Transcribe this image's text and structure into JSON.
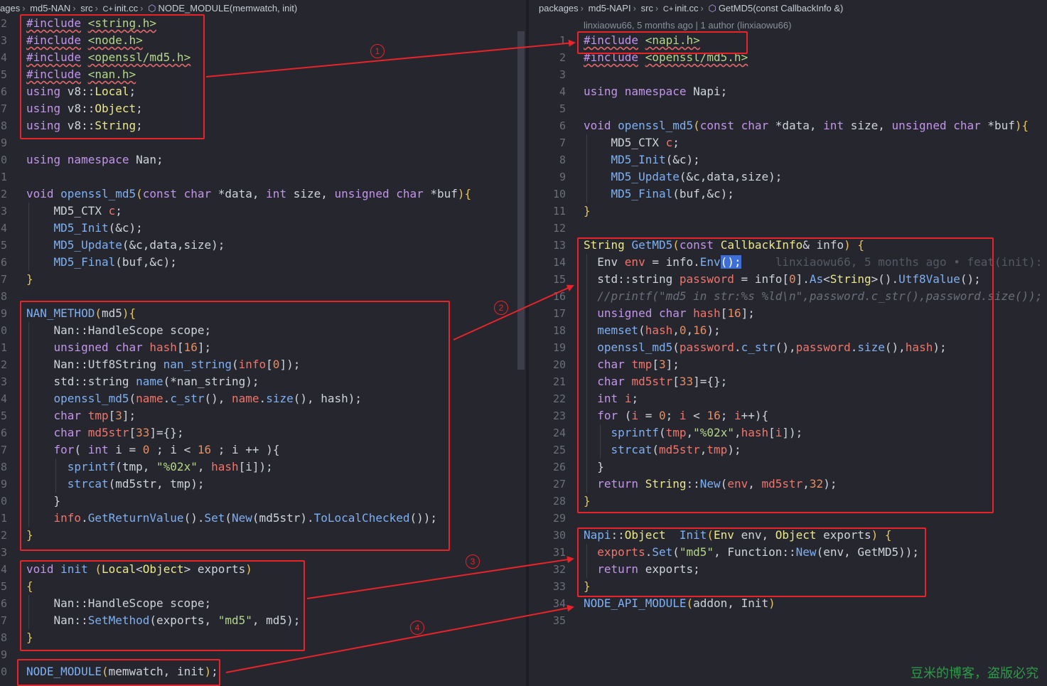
{
  "left_editor": {
    "breadcrumb": [
      "ages",
      "md5-NAN",
      "src",
      "init.cc",
      "NODE_MODULE(memwatch, init)"
    ],
    "lines": [
      {
        "n": "2",
        "html": "<span class=\"pp\">#include</span> <span class=\"ppstr\">&lt;string.h&gt;</span>"
      },
      {
        "n": "3",
        "html": "<span class=\"pp\">#include</span> <span class=\"ppstr\">&lt;node.h&gt;</span>"
      },
      {
        "n": "4",
        "html": "<span class=\"pp\">#include</span> <span class=\"ppstr\">&lt;openssl/md5.h&gt;</span>"
      },
      {
        "n": "5",
        "html": "<span class=\"pp\">#include</span> <span class=\"ppstr\">&lt;nan.h&gt;</span>"
      },
      {
        "n": "6",
        "html": "<span class=\"kw\">using</span> v8::<span class=\"ty\">Local</span>;"
      },
      {
        "n": "7",
        "html": "<span class=\"kw\">using</span> v8::<span class=\"ty\">Object</span>;"
      },
      {
        "n": "8",
        "html": "<span class=\"kw\">using</span> v8::<span class=\"ty\">String</span>;"
      },
      {
        "n": "9",
        "html": ""
      },
      {
        "n": "0",
        "html": "<span class=\"kw\">using namespace</span> Nan;"
      },
      {
        "n": "1",
        "html": ""
      },
      {
        "n": "2",
        "html": "<span class=\"kw\">void</span> <span class=\"fn\">openssl_md5</span><span class=\"br\">(</span><span class=\"kw\">const char</span> *data, <span class=\"kw\">int</span> size, <span class=\"kw\">unsigned char</span> *buf<span class=\"br\">){</span>"
      },
      {
        "n": "3",
        "html": "    MD5_CTX <span class=\"var\">c</span>;"
      },
      {
        "n": "4",
        "html": "    <span class=\"fn\">MD5_Init</span>(&amp;c);"
      },
      {
        "n": "5",
        "html": "    <span class=\"fn\">MD5_Update</span>(&amp;c,data,size);"
      },
      {
        "n": "6",
        "html": "    <span class=\"fn\">MD5_Final</span>(buf,&amp;c);"
      },
      {
        "n": "7",
        "html": "<span class=\"br\">}</span>"
      },
      {
        "n": "8",
        "html": ""
      },
      {
        "n": "9",
        "html": "<span class=\"fn\">NAN_METHOD</span><span class=\"br\">(</span>md5<span class=\"br\">){</span>"
      },
      {
        "n": "0",
        "html": "    Nan::HandleScope scope;"
      },
      {
        "n": "1",
        "html": "    <span class=\"kw\">unsigned char</span> <span class=\"var\">hash</span>[<span class=\"num\">16</span>];"
      },
      {
        "n": "2",
        "html": "    Nan::Utf8String <span class=\"fn\">nan_string</span>(<span class=\"var\">info</span>[<span class=\"num\">0</span>]);"
      },
      {
        "n": "3",
        "html": "    std::string <span class=\"fn\">name</span>(*nan_string);"
      },
      {
        "n": "4",
        "html": "    <span class=\"fn\">openssl_md5</span>(<span class=\"var\">name</span>.<span class=\"fn\">c_str</span>(), <span class=\"var\">name</span>.<span class=\"fn\">size</span>(), hash);"
      },
      {
        "n": "5",
        "html": "    <span class=\"kw\">char</span> <span class=\"var\">tmp</span>[<span class=\"num\">3</span>];"
      },
      {
        "n": "6",
        "html": "    <span class=\"kw\">char</span> <span class=\"var\">md5str</span>[<span class=\"num\">33</span>]={};"
      },
      {
        "n": "7",
        "html": "    <span class=\"kw\">for</span>( <span class=\"kw\">int</span> i = <span class=\"num\">0</span> ; i &lt; <span class=\"num\">16</span> ; i ++ ){"
      },
      {
        "n": "8",
        "html": "      <span class=\"fn\">sprintf</span>(tmp, <span class=\"str\">\"%02x\"</span>, <span class=\"var\">hash</span>[i]);"
      },
      {
        "n": "9",
        "html": "      <span class=\"fn\">strcat</span>(md5str, tmp);"
      },
      {
        "n": "0",
        "html": "    }"
      },
      {
        "n": "1",
        "html": "    <span class=\"var\">info</span>.<span class=\"fn\">GetReturnValue</span>().<span class=\"fn\">Set</span>(<span class=\"fn\">New</span>(md5str).<span class=\"fn\">ToLocalChecked</span>());"
      },
      {
        "n": "2",
        "html": "<span class=\"br\">}</span>"
      },
      {
        "n": "3",
        "html": ""
      },
      {
        "n": "4",
        "html": "<span class=\"kw\">void</span> <span class=\"fn\">init</span> <span class=\"br\">(</span><span class=\"ty\">Local</span>&lt;<span class=\"ty\">Object</span>&gt; exports<span class=\"br\">)</span>"
      },
      {
        "n": "5",
        "html": "<span class=\"br\">{</span>"
      },
      {
        "n": "6",
        "html": "    Nan::HandleScope scope;"
      },
      {
        "n": "7",
        "html": "    Nan::<span class=\"fn\">SetMethod</span>(exports, <span class=\"str\">\"md5\"</span>, md5);"
      },
      {
        "n": "8",
        "html": "<span class=\"br\">}</span>"
      },
      {
        "n": "9",
        "html": ""
      },
      {
        "n": "0",
        "html": "<span class=\"fn\">NODE_MODULE</span><span class=\"br\">(</span>memwatch, init<span class=\"br\">)</span>;"
      }
    ]
  },
  "right_editor": {
    "breadcrumb": [
      "packages",
      "md5-NAPI",
      "src",
      "init.cc",
      "GetMD5(const CallbackInfo &)"
    ],
    "blame": "linxiaowu66, 5 months ago | 1 author (linxiaowu66)",
    "lines": [
      {
        "n": "1",
        "html": "<span class=\"pp\">#include</span> <span class=\"ppstr\">&lt;napi.h&gt;</span>"
      },
      {
        "n": "2",
        "html": "<span class=\"pp\">#include</span> <span class=\"ppstr\">&lt;openssl/md5.h&gt;</span>"
      },
      {
        "n": "3",
        "html": ""
      },
      {
        "n": "4",
        "html": "<span class=\"kw\">using namespace</span> Napi;"
      },
      {
        "n": "5",
        "html": ""
      },
      {
        "n": "6",
        "html": "<span class=\"kw\">void</span> <span class=\"fn\">openssl_md5</span><span class=\"br\">(</span><span class=\"kw\">const char</span> *data, <span class=\"kw\">int</span> size, <span class=\"kw\">unsigned char</span> *buf<span class=\"br\">){</span>"
      },
      {
        "n": "7",
        "html": "    MD5_CTX <span class=\"var\">c</span>;"
      },
      {
        "n": "8",
        "html": "    <span class=\"fn\">MD5_Init</span>(&amp;c);"
      },
      {
        "n": "9",
        "html": "    <span class=\"fn\">MD5_Update</span>(&amp;c,data,size);"
      },
      {
        "n": "10",
        "html": "    <span class=\"fn\">MD5_Final</span>(buf,&amp;c);"
      },
      {
        "n": "11",
        "html": "<span class=\"br\">}</span>"
      },
      {
        "n": "12",
        "html": ""
      },
      {
        "n": "13",
        "html": "<span class=\"ty\">String</span> <span class=\"fn\">GetMD5</span><span class=\"br\">(</span><span class=\"kw\">const</span> <span class=\"ty\">CallbackInfo</span>&amp; info<span class=\"br\">)</span> <span class=\"br\">{</span>"
      },
      {
        "n": "14",
        "html": "  Env <span class=\"var\">env</span> = info.<span class=\"fn\">Env</span><span class=\"cursor\">();</span>     <span class=\"ghost\">linxiaowu66, 5 months ago • feat(init):</span>"
      },
      {
        "n": "15",
        "html": "  std::string <span class=\"var\">password</span> = info[<span class=\"num\">0</span>].<span class=\"fn\">As</span>&lt;<span class=\"ty\">String</span>&gt;().<span class=\"fn\">Utf8Value</span>();"
      },
      {
        "n": "16",
        "html": "  <span class=\"cm\">//printf(\"md5 in str:%s %ld\\n\",password.c_str(),password.size());</span>"
      },
      {
        "n": "17",
        "html": "  <span class=\"kw\">unsigned char</span> <span class=\"var\">hash</span>[<span class=\"num\">16</span>];"
      },
      {
        "n": "18",
        "html": "  <span class=\"fn\">memset</span>(<span class=\"var\">hash</span>,<span class=\"num\">0</span>,<span class=\"num\">16</span>);"
      },
      {
        "n": "19",
        "html": "  <span class=\"fn\">openssl_md5</span>(<span class=\"var\">password</span>.<span class=\"fn\">c_str</span>(),<span class=\"var\">password</span>.<span class=\"fn\">size</span>(),<span class=\"var\">hash</span>);"
      },
      {
        "n": "20",
        "html": "  <span class=\"kw\">char</span> <span class=\"var\">tmp</span>[<span class=\"num\">3</span>];"
      },
      {
        "n": "21",
        "html": "  <span class=\"kw\">char</span> <span class=\"var\">md5str</span>[<span class=\"num\">33</span>]={};"
      },
      {
        "n": "22",
        "html": "  <span class=\"kw\">int</span> <span class=\"var\">i</span>;"
      },
      {
        "n": "23",
        "html": "  <span class=\"kw\">for</span> (<span class=\"var\">i</span> = <span class=\"num\">0</span>; <span class=\"var\">i</span> &lt; <span class=\"num\">16</span>; <span class=\"var\">i</span>++){"
      },
      {
        "n": "24",
        "html": "    <span class=\"fn\">sprintf</span>(<span class=\"var\">tmp</span>,<span class=\"str\">\"%02x\"</span>,<span class=\"var\">hash</span>[<span class=\"var\">i</span>]);"
      },
      {
        "n": "25",
        "html": "    <span class=\"fn\">strcat</span>(<span class=\"var\">md5str</span>,<span class=\"var\">tmp</span>);"
      },
      {
        "n": "26",
        "html": "  }"
      },
      {
        "n": "27",
        "html": "  <span class=\"kw\">return</span> <span class=\"ty\">String</span>::<span class=\"fn\">New</span>(<span class=\"var\">env</span>, <span class=\"var\">md5str</span>,<span class=\"num\">32</span>);"
      },
      {
        "n": "28",
        "html": "<span class=\"br\">}</span>"
      },
      {
        "n": "29",
        "html": ""
      },
      {
        "n": "30",
        "html": "<span class=\"fn\">Napi</span>::<span class=\"ty\">Object</span>  <span class=\"fn\">Init</span><span class=\"br\">(</span><span class=\"ty\">Env</span> env, <span class=\"ty\">Object</span> exports<span class=\"br\">)</span> <span class=\"br\">{</span>"
      },
      {
        "n": "31",
        "html": "  <span class=\"var\">exports</span>.<span class=\"fn\">Set</span>(<span class=\"str\">\"md5\"</span>, Function::<span class=\"fn\">New</span>(env, GetMD5));"
      },
      {
        "n": "32",
        "html": "  <span class=\"kw\">return</span> exports;"
      },
      {
        "n": "33",
        "html": "<span class=\"br\">}</span>"
      },
      {
        "n": "34",
        "html": "<span class=\"fn\">NODE_API_MODULE</span><span class=\"br\">(</span>addon, Init<span class=\"br\">)</span>"
      },
      {
        "n": "35",
        "html": ""
      }
    ]
  },
  "annotations": {
    "labels": [
      "1",
      "2",
      "3",
      "4"
    ]
  },
  "watermark": "豆米的博客，盗版必究",
  "colors": {
    "annotation": "#e8242a",
    "keyword": "#c395ea",
    "function": "#7fb0f2",
    "type": "#ece889",
    "string": "#b5d78a",
    "number": "#e58e63"
  }
}
